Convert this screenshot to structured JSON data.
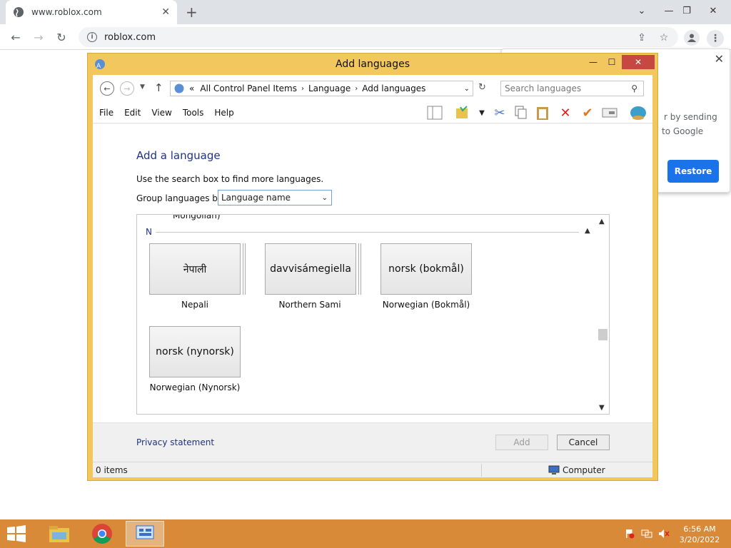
{
  "browser": {
    "tab_title": "www.roblox.com",
    "url": "roblox.com",
    "popup": {
      "text_line1": "r by sending",
      "text_line2": "to Google",
      "restore_label": "Restore"
    }
  },
  "window": {
    "title": "Add languages",
    "breadcrumb": [
      "All Control Panel Items",
      "Language",
      "Add languages"
    ],
    "breadcrumb_prefix": "«",
    "search_placeholder": "Search languages",
    "menu": [
      "File",
      "Edit",
      "View",
      "Tools",
      "Help"
    ],
    "heading": "Add a language",
    "hint": "Use the search box to find more languages.",
    "group_by_label": "Group languages by:",
    "group_by_value": "Language name",
    "previous_group_tail": "Mongolian)",
    "section_letter": "N",
    "languages": [
      {
        "native": "नेपाली",
        "name": "Nepali"
      },
      {
        "native": "davvisámegiella",
        "name": "Northern Sami"
      },
      {
        "native": "norsk (bokmål)",
        "name": "Norwegian (Bokmål)"
      },
      {
        "native": "norsk (nynorsk)",
        "name": "Norwegian (Nynorsk)"
      }
    ],
    "privacy_link": "Privacy statement",
    "add_label": "Add",
    "cancel_label": "Cancel",
    "status_items": "0 items",
    "status_location": "Computer"
  },
  "taskbar": {
    "time": "6:56 AM",
    "date": "3/20/2022"
  },
  "colors": {
    "window_frame": "#f1c75e",
    "taskbar": "#d88a39",
    "link_blue": "#1e3287",
    "chrome_blue": "#1a73e8",
    "close_red": "#c74842"
  }
}
